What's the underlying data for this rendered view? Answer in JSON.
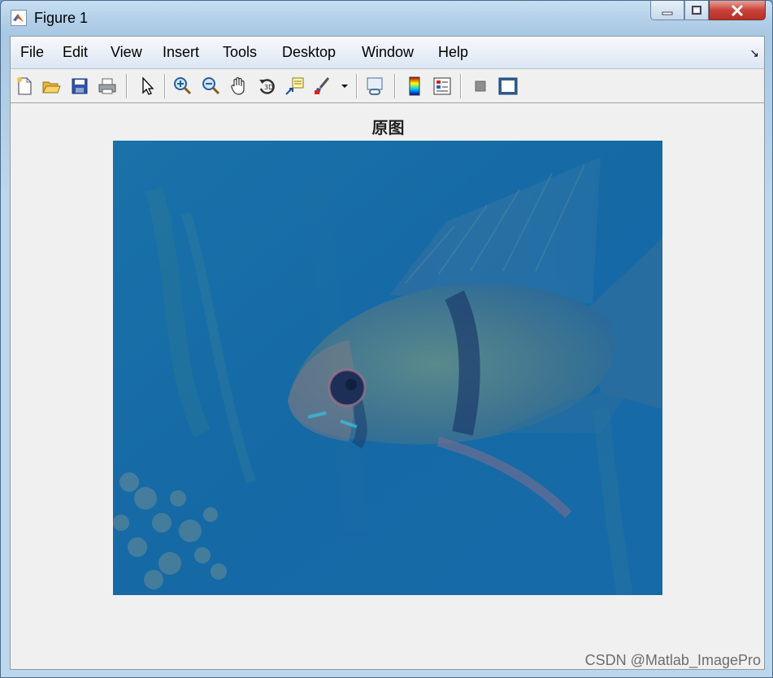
{
  "window": {
    "title": "Figure 1"
  },
  "menu": {
    "items": [
      "File",
      "Edit",
      "View",
      "Insert",
      "Tools",
      "Desktop",
      "Window",
      "Help"
    ],
    "arrow": "↘"
  },
  "toolbar": {
    "tools": [
      {
        "icon": "new-figure-icon"
      },
      {
        "icon": "open-file-icon"
      },
      {
        "icon": "save-icon"
      },
      {
        "icon": "print-icon"
      },
      {
        "icon": "pointer-icon"
      },
      {
        "icon": "zoom-in-icon"
      },
      {
        "icon": "zoom-out-icon"
      },
      {
        "icon": "pan-hand-icon"
      },
      {
        "icon": "rotate-3d-icon"
      },
      {
        "icon": "data-cursor-icon"
      },
      {
        "icon": "brush-icon"
      },
      {
        "icon": "link-plot-icon"
      },
      {
        "icon": "colorbar-icon"
      },
      {
        "icon": "legend-icon"
      },
      {
        "icon": "hide-plot-tools-icon"
      },
      {
        "icon": "show-plot-tools-icon"
      }
    ]
  },
  "figure": {
    "title": "原图",
    "image_description_colors": {
      "water": "#1670a8",
      "fish_body": "#4b7f8e"
    }
  },
  "watermark": "CSDN @Matlab_ImagePro"
}
